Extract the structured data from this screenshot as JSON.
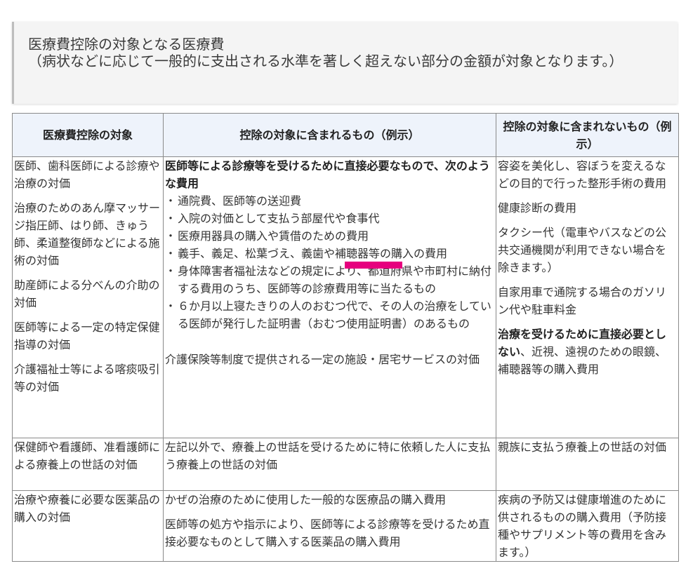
{
  "header": {
    "title": "医療費控除の対象となる医療費",
    "subtitle": "（病状などに応じて一般的に支出される水準を著しく超えない部分の金額が対象となります。）"
  },
  "table": {
    "headers": [
      "医療費控除の対象",
      "控除の対象に含まれるもの（例示）",
      "控除の対象に含まれないもの（例示）"
    ],
    "rows": [
      {
        "targets": [
          "医師、歯科医師による診療や治療の対価",
          "治療のためのあん摩マッサージ指圧師、はり師、きゅう師、柔道整復師などによる施術の対価",
          "助産師による分べんの介助の対価",
          "医師等による一定の特定保健指導の対価",
          "介護福祉士等による喀痰吸引等の対価"
        ],
        "included_heading": "医師等による診療等を受けるために直接必要なもので、次のような費用",
        "included_items": [
          "通院費、医師等の送迎費",
          "入院の対価として支払う部屋代や食事代",
          "医療用器具の購入や賃借のための費用",
          "義手、義足、松葉づえ、義歯や補聴器等の購入の費用",
          "身体障害者福祉法などの規定により、都道府県や市町村に納付する費用のうち、医師等の診療費用等に当たるもの",
          "６か月以上寝たきりの人のおむつ代で、その人の治療をしている医師が発行した証明書（おむつ使用証明書）のあるもの"
        ],
        "included_note": "介護保険等制度で提供される一定の施設・居宅サービスの対価",
        "excluded": [
          "容姿を美化し、容ぼうを変えるなどの目的で行った整形手術の費用",
          "健康診断の費用",
          "タクシー代（電車やバスなどの公共交通機関が利用できない場合を除きます。）",
          "自家用車で通院する場合のガソリン代や駐車料金"
        ],
        "excluded_last_bold": "治療を受けるために直接必要としない",
        "excluded_last_rest": "、近視、遠視のための眼鏡、補聴器等の購入費用"
      },
      {
        "target": "保健師や看護師、准看護師による療養上の世話の対価",
        "included": "左記以外で、療養上の世話を受けるために特に依頼した人に支払う療養上の世話の対価",
        "excluded": "親族に支払う療養上の世話の対価"
      },
      {
        "target": "治療や療養に必要な医薬品の購入の対価",
        "included": [
          "かぜの治療のために使用した一般的な医療品の購入費用",
          "医師等の処方や指示により、医師等による診療等を受けるため直接必要なものとして購入する医薬品の購入費用"
        ],
        "excluded": "疾病の予防又は健康増進のために供されるものの購入費用（予防接種やサプリメント等の費用を含みます。）"
      }
    ]
  },
  "highlight_color": "#e6007e"
}
